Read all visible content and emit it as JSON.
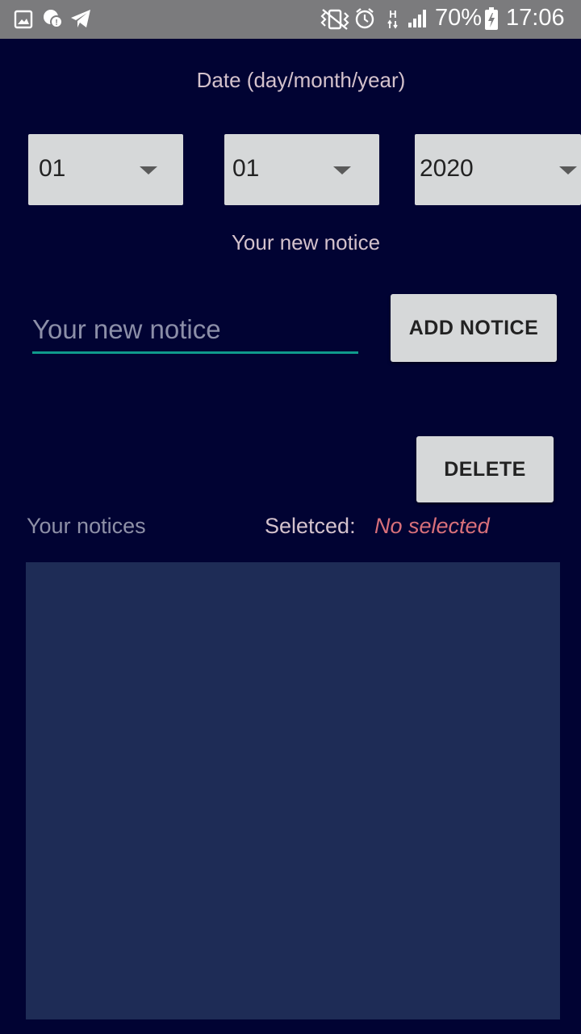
{
  "status_bar": {
    "left_icons": [
      "gallery-icon",
      "chat-icon",
      "telegram-icon"
    ],
    "right_icons": [
      "vibrate-icon",
      "alarm-icon",
      "network-h-icon",
      "signal-icon",
      "battery-charging-icon"
    ],
    "battery_percent": "70%",
    "time": "17:06"
  },
  "date": {
    "label": "Date (day/month/year)",
    "day": "01",
    "month": "01",
    "year": "2020"
  },
  "notice": {
    "label": "Your new notice",
    "input_value": "",
    "input_placeholder": "Your new notice",
    "add_button": "ADD NOTICE"
  },
  "delete_button": "DELETE",
  "list": {
    "title": "Your notices",
    "selected_label": "Seletced:",
    "selected_value": "No selected",
    "items": []
  },
  "colors": {
    "background": "#010333",
    "list_background": "#1e2c56",
    "accent_underline": "#0f9b8c",
    "selected_value": "#d9707a"
  }
}
